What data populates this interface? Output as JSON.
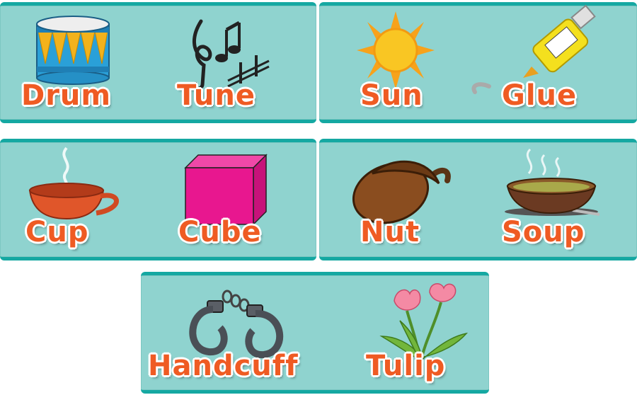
{
  "cards": [
    {
      "left": {
        "word": "Drum",
        "icon": "drum-icon"
      },
      "right": {
        "word": "Tune",
        "icon": "music-notes-icon"
      }
    },
    {
      "left": {
        "word": "Sun",
        "icon": "sun-icon"
      },
      "right": {
        "word": "Glue",
        "icon": "glue-bottle-icon"
      }
    },
    {
      "left": {
        "word": "Cup",
        "icon": "cup-icon"
      },
      "right": {
        "word": "Cube",
        "icon": "cube-icon"
      }
    },
    {
      "left": {
        "word": "Nut",
        "icon": "acorn-icon"
      },
      "right": {
        "word": "Soup",
        "icon": "soup-bowl-icon"
      }
    },
    {
      "left": {
        "word": "Handcuff",
        "icon": "handcuffs-icon"
      },
      "right": {
        "word": "Tulip",
        "icon": "tulip-icon"
      }
    }
  ],
  "colors": {
    "card_bg": "#8fd3cf",
    "card_border": "#15a8a2",
    "word": "#ef5b23"
  }
}
